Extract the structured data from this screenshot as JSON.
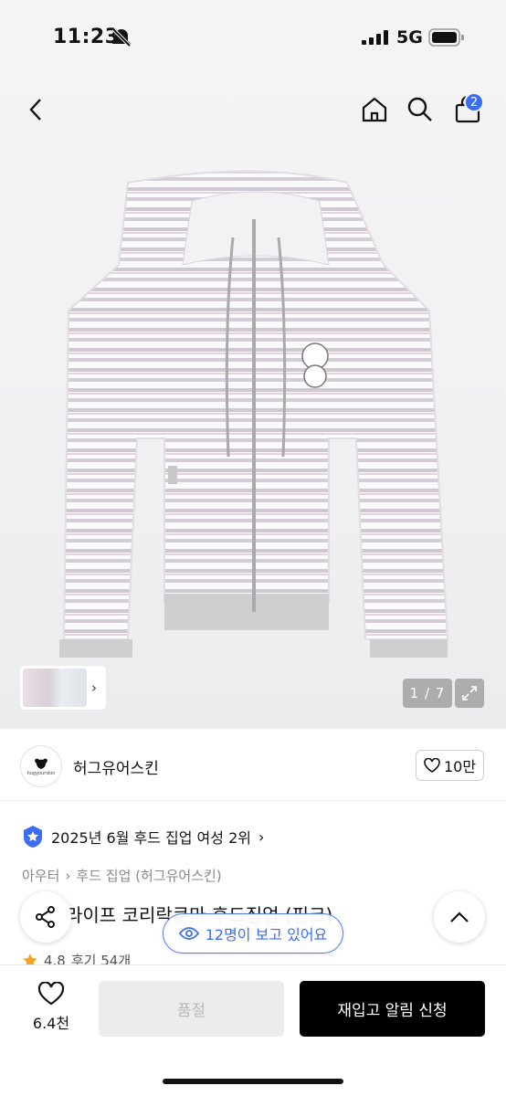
{
  "status_bar": {
    "time": "11:23",
    "network": "5G"
  },
  "nav": {
    "cart_count": "2"
  },
  "gallery": {
    "counter": "1 / 7"
  },
  "brand": {
    "name": "허그유어스킨",
    "logo_text": "hugyourskin",
    "likes": "10만"
  },
  "ranking": {
    "text": "2025년 6월 후드 집업 여성 2위"
  },
  "category": {
    "level1": "아우터",
    "level2": "후드 집업 (허그유어스킨)"
  },
  "product": {
    "title": "라이프 코리락쿠마 후드집업 (핑크)",
    "rating": "4.8",
    "reviews": "후기 54개"
  },
  "viewers": {
    "text": "12명이 보고 있어요"
  },
  "bottom": {
    "wish_count": "6.4천",
    "soldout_label": "품절",
    "restock_label": "재입고 알림 신청"
  },
  "colors": {
    "accent": "#3b6cf6",
    "star": "#f5a623"
  }
}
